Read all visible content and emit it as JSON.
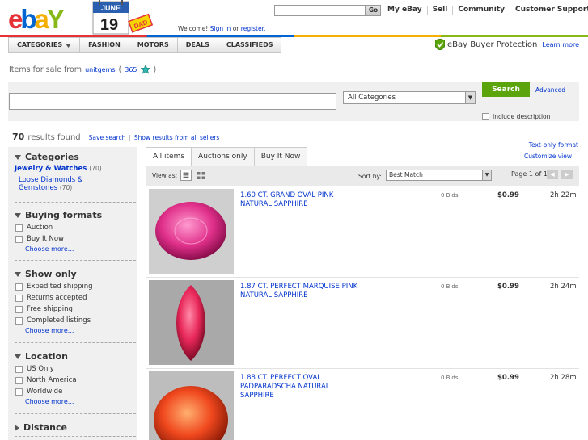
{
  "header": {
    "logo_text": "ebay",
    "doodle": {
      "month": "JUNE",
      "day": "19",
      "note": "DAD"
    },
    "welcome": "Welcome!",
    "sign_in": "Sign in",
    "or": "or",
    "register": "register.",
    "go_label": "Go",
    "top_nav": [
      "My eBay",
      "Sell",
      "Community",
      "Customer Support"
    ]
  },
  "navbar": {
    "tabs": [
      "CATEGORIES",
      "FASHION",
      "MOTORS",
      "DEALS",
      "CLASSIFIEDS"
    ],
    "protection": "eBay Buyer Protection",
    "learn_more": "Learn more"
  },
  "seller": {
    "prefix": "Items for sale from",
    "name": "unitgems",
    "open_paren": "(",
    "score": "365",
    "close_paren": ")"
  },
  "search": {
    "category": "All Categories",
    "button": "Search",
    "advanced": "Advanced",
    "include_description": "Include description"
  },
  "results": {
    "count": "70",
    "label": "results found",
    "save_search": "Save search",
    "separator": "|",
    "show_all_sellers": "Show results from all sellers",
    "text_only": "Text-only format",
    "customize": "Customize view"
  },
  "sidebar": {
    "categories": {
      "heading": "Categories",
      "top": "Jewelry & Watches",
      "top_count": "(70)",
      "sub": "Loose Diamonds & Gemstones",
      "sub_count": "(70)"
    },
    "buying_formats": {
      "heading": "Buying formats",
      "options": [
        "Auction",
        "Buy It Now"
      ],
      "more": "Choose more..."
    },
    "show_only": {
      "heading": "Show only",
      "options": [
        "Expedited shipping",
        "Returns accepted",
        "Free shipping",
        "Completed listings"
      ],
      "more": "Choose more..."
    },
    "location": {
      "heading": "Location",
      "options": [
        "US Only",
        "North America",
        "Worldwide"
      ],
      "more": "Choose more..."
    },
    "distance": {
      "heading": "Distance"
    }
  },
  "tabs": [
    "All items",
    "Auctions only",
    "Buy It Now"
  ],
  "viewbar": {
    "view_as": "View as:",
    "sort_by": "Sort by:",
    "sort_value": "Best Match",
    "page": "Page 1 of 1"
  },
  "items": [
    {
      "title": "1.60 CT. GRAND OVAL PINK NATURAL SAPPHIRE",
      "bids": "0 Bids",
      "price": "$0.99",
      "time": "2h 22m",
      "color": "#e0308a"
    },
    {
      "title": "1.87 CT. PERFECT MARQUISE PINK NATURAL SAPPHIRE",
      "bids": "0 Bids",
      "price": "$0.99",
      "time": "2h 24m",
      "color": "#e8285a"
    },
    {
      "title": "1.88 CT. PERFECT OVAL PADPARADSCHA NATURAL SAPPHIRE",
      "bids": "0 Bids",
      "price": "$0.99",
      "time": "2h 28m",
      "color": "#f0481e"
    }
  ],
  "colors": {
    "link": "#0033cc",
    "search_button": "#5ba40c",
    "ebay_red": "#e53238",
    "ebay_blue": "#0064d2",
    "ebay_yellow": "#f5af02",
    "ebay_green": "#86b817"
  }
}
